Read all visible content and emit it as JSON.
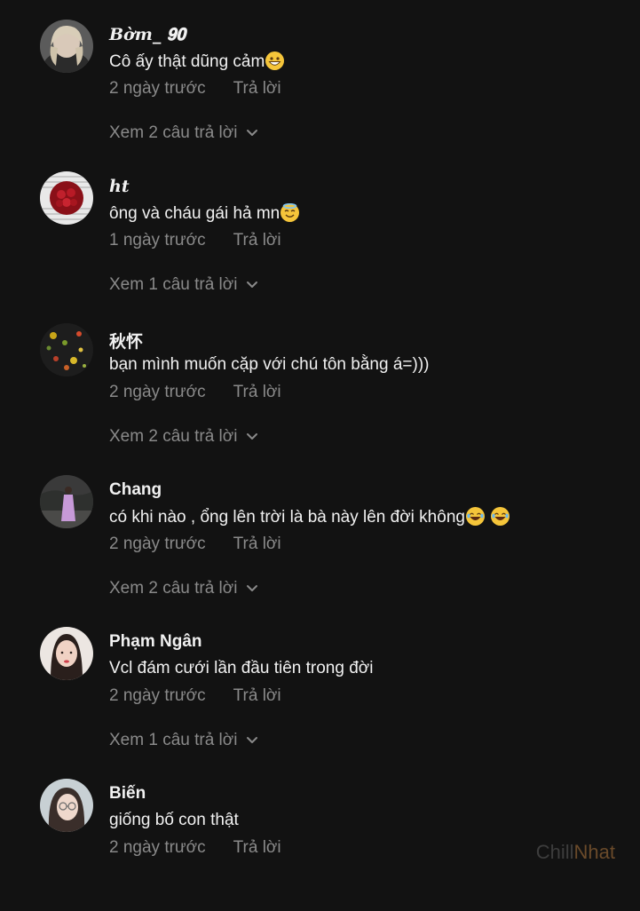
{
  "colors": {
    "background": "#121212",
    "primary_text": "#f1f1f1",
    "secondary_text": "#8a8a8a",
    "emoji_yellow": "#f5c53a"
  },
  "comments": [
    {
      "username": "𝑩𝒐̛̀𝒎_ 𝟗𝟎",
      "text": "Cô ấy thật dũng cảm",
      "emoji": "grinning-face-emoji",
      "time": "2 ngày trước",
      "reply": "Trả lời",
      "view_replies": "Xem 2 câu trả lời"
    },
    {
      "username": "𝒉𝒕",
      "text": "ông và cháu gái hả mn",
      "emoji": "angel-face-emoji",
      "time": "1 ngày trước",
      "reply": "Trả lời",
      "view_replies": "Xem 1 câu trả lời"
    },
    {
      "username": "秋怀",
      "text": "bạn mình muốn cặp với chú tôn bằng á=)))",
      "time": "2 ngày trước",
      "reply": "Trả lời",
      "view_replies": "Xem 2 câu trả lời"
    },
    {
      "username": "Chang",
      "text": "có khi nào , ổng lên trời là bà này lên đời không",
      "emoji": "laughing-face-emoji",
      "time": "2 ngày trước",
      "reply": "Trả lời",
      "view_replies": "Xem 2 câu trả lời"
    },
    {
      "username": "Phạm Ngân",
      "text": "Vcl đám cưới lần đầu tiên trong đời",
      "time": "2 ngày trước",
      "reply": "Trả lời",
      "view_replies": "Xem 1 câu trả lời"
    },
    {
      "username": "Biến",
      "text": "giống bố con thật",
      "time": "2 ngày trước",
      "reply": "Trả lời"
    }
  ],
  "watermark": {
    "part1": "Chill",
    "part2": "Nhat"
  }
}
